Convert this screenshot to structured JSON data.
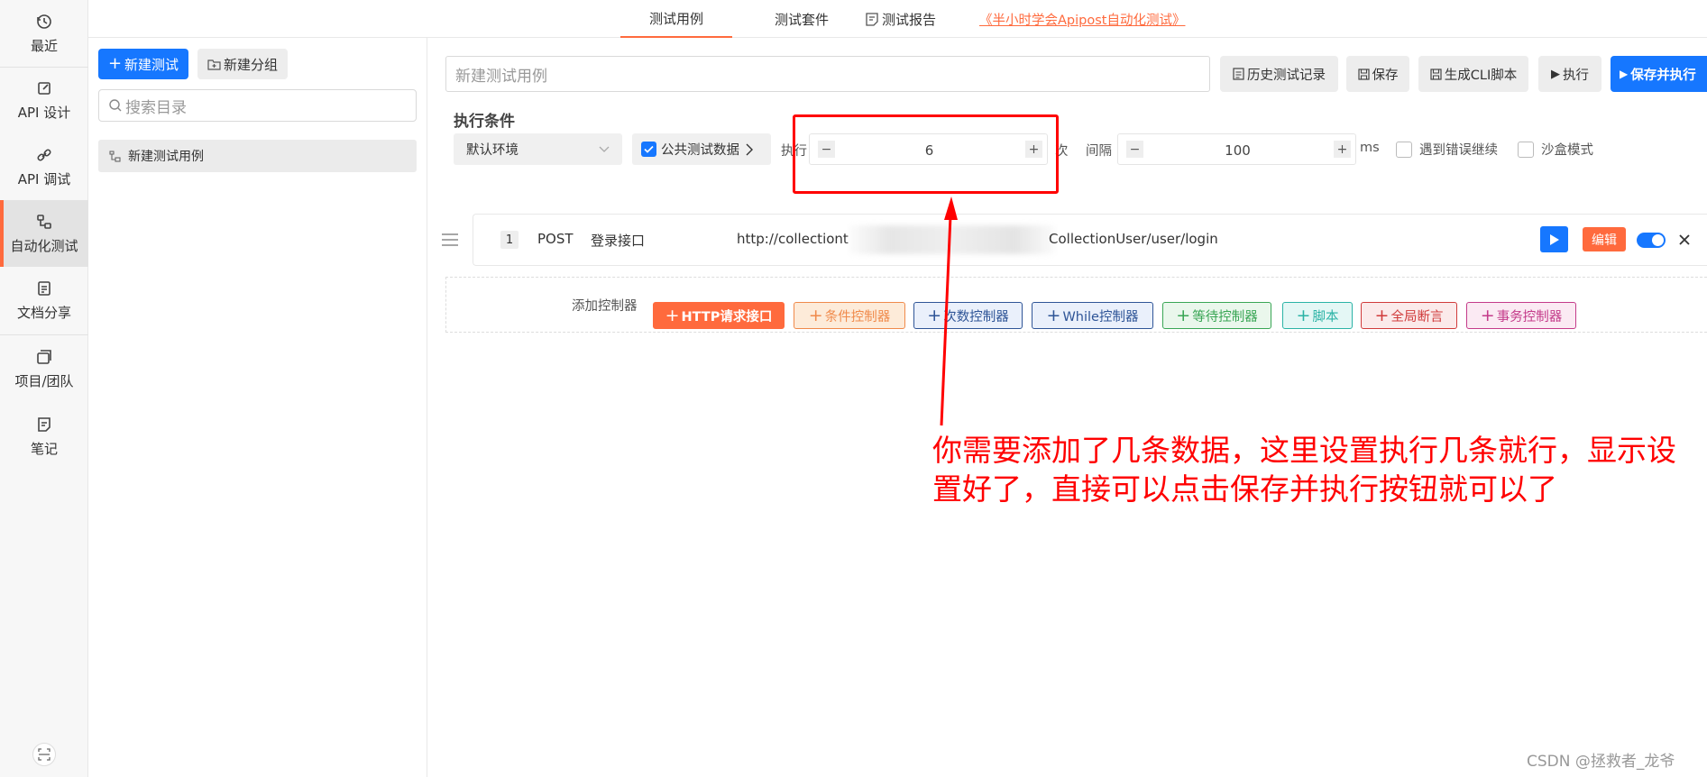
{
  "rail": {
    "items": [
      {
        "label": "最近",
        "icon": "clock-history-icon"
      },
      {
        "label": "API 设计",
        "icon": "edit-box-icon"
      },
      {
        "label": "API 调试",
        "icon": "link-chain-icon"
      },
      {
        "label": "自动化测试",
        "icon": "flow-nodes-icon"
      },
      {
        "label": "文档分享",
        "icon": "share-doc-icon"
      },
      {
        "label": "项目/团队",
        "icon": "layers-icon"
      },
      {
        "label": "笔记",
        "icon": "note-icon"
      }
    ],
    "active_index": 3
  },
  "tabs": [
    {
      "label": "测试用例"
    },
    {
      "label": "测试套件"
    },
    {
      "label": "测试报告"
    }
  ],
  "tutorial_link": "《半小时学会Apipost自动化测试》",
  "sidebar": {
    "new_test_label": "新建测试",
    "new_group_label": "新建分组",
    "search_placeholder": "搜索目录",
    "tree_item": "新建测试用例"
  },
  "toolbar": {
    "case_name_placeholder": "新建测试用例",
    "history_label": "历史测试记录",
    "save_label": "保存",
    "cli_label": "生成CLI脚本",
    "run_label": "执行",
    "save_run_label": "保存并执行"
  },
  "conditions": {
    "title": "执行条件",
    "env_value": "默认环境",
    "public_data_label": "公共测试数据",
    "public_data_checked": true,
    "exec_label": "执行",
    "exec_count": "6",
    "exec_unit": "次",
    "interval_label": "间隔",
    "interval_value": "100",
    "interval_unit": "ms",
    "continue_on_error": "遇到错误继续",
    "sandbox": "沙盒模式"
  },
  "steps": [
    {
      "index": "1",
      "method": "POST",
      "name": "登录接口",
      "url_start": "http://collectiont",
      "url_end": "CollectionUser/user/login",
      "edit_label": "编辑",
      "enabled": true
    }
  ],
  "controllers": {
    "label": "添加控制器",
    "items": [
      {
        "label": "HTTP请求接口",
        "color": "#ff6a3d"
      },
      {
        "label": "条件控制器",
        "color": "#f08a4b"
      },
      {
        "label": "次数控制器",
        "color": "#2f5597"
      },
      {
        "label": "While控制器",
        "color": "#2f5597"
      },
      {
        "label": "等待控制器",
        "color": "#3aa655"
      },
      {
        "label": "脚本",
        "color": "#2bb3a6"
      },
      {
        "label": "全局断言",
        "color": "#d03b3b"
      },
      {
        "label": "事务控制器",
        "color": "#c43b8a"
      }
    ]
  },
  "annotation": {
    "line1": "你需要添加了几条数据，这里设置执行几条就行，显示设",
    "line2": "置好了，直接可以点击保存并执行按钮就可以了",
    "color": "#ff0000"
  },
  "watermark": "CSDN @拯救者_龙爷",
  "accent": "#1677ff",
  "brand": "#ff6a3d"
}
